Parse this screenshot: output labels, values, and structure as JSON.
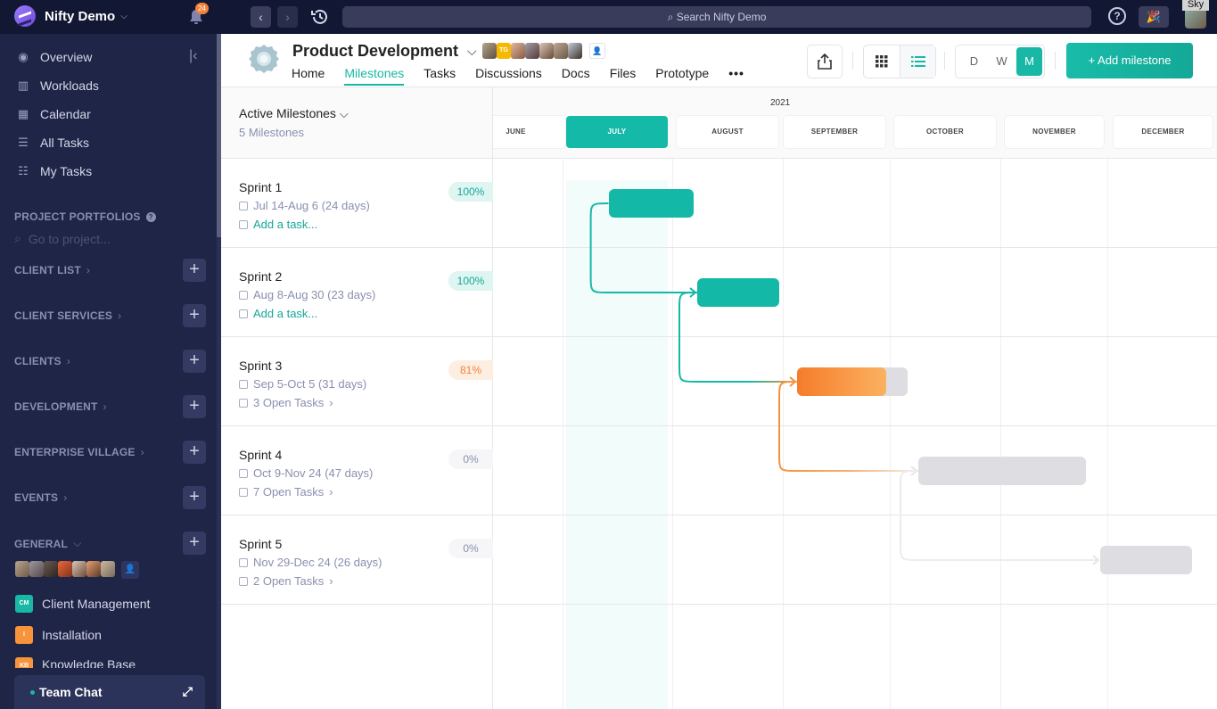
{
  "topbar": {
    "workspace_name": "Nifty Demo",
    "notification_count": "24",
    "search_placeholder": "Search Nifty Demo",
    "user_tooltip": "Sky",
    "back_glyph": "‹",
    "forward_glyph": "›",
    "help_glyph": "?",
    "party_glyph": "🎉"
  },
  "sidebar": {
    "nav": [
      {
        "label": "Overview",
        "icon": "compass-icon"
      },
      {
        "label": "Workloads",
        "icon": "bar-chart-icon"
      },
      {
        "label": "Calendar",
        "icon": "calendar-icon"
      },
      {
        "label": "All Tasks",
        "icon": "list-icon"
      },
      {
        "label": "My Tasks",
        "icon": "checklist-icon"
      }
    ],
    "portfolios_title": "PROJECT PORTFOLIOS",
    "goto_placeholder": "Go to project...",
    "sections": [
      {
        "label": "CLIENT LIST"
      },
      {
        "label": "CLIENT SERVICES"
      },
      {
        "label": "CLIENTS"
      },
      {
        "label": "DEVELOPMENT"
      },
      {
        "label": "ENTERPRISE VILLAGE"
      },
      {
        "label": "EVENTS"
      },
      {
        "label": "GENERAL"
      }
    ],
    "projects": [
      {
        "label": "Client Management",
        "badge": "CM",
        "color": "#19b7a5"
      },
      {
        "label": "Installation",
        "badge": "I",
        "color": "#f7933a"
      },
      {
        "label": "Knowledge Base",
        "badge": "KB",
        "color": "#f7933a"
      }
    ],
    "team_chat": "Team Chat",
    "plus_glyph": "+"
  },
  "project": {
    "title": "Product Development",
    "member_initials": "TG",
    "tabs": [
      "Home",
      "Milestones",
      "Tasks",
      "Discussions",
      "Docs",
      "Files",
      "Prototype"
    ],
    "active_tab": "Milestones",
    "more_glyph": "•••",
    "view_modes": [
      "D",
      "W",
      "M"
    ],
    "active_view_mode": "M",
    "add_milestone_label": "+ Add milestone"
  },
  "milestones_panel": {
    "title": "Active Milestones",
    "count_label": "5 Milestones",
    "items": [
      {
        "name": "Sprint 1",
        "dates": "Jul 14-Aug 6 (24 days)",
        "tasks": "Add a task...",
        "tasks_is_add": true,
        "percent": "100%",
        "progress": 1.0,
        "status": "complete"
      },
      {
        "name": "Sprint 2",
        "dates": "Aug 8-Aug 30 (23 days)",
        "tasks": "Add a task...",
        "tasks_is_add": true,
        "percent": "100%",
        "progress": 1.0,
        "status": "complete"
      },
      {
        "name": "Sprint 3",
        "dates": "Sep 5-Oct 5 (31 days)",
        "tasks": "3 Open Tasks",
        "tasks_is_add": false,
        "percent": "81%",
        "progress": 0.81,
        "status": "in-progress"
      },
      {
        "name": "Sprint 4",
        "dates": "Oct 9-Nov 24 (47 days)",
        "tasks": "7 Open Tasks",
        "tasks_is_add": false,
        "percent": "0%",
        "progress": 0,
        "status": "not-started"
      },
      {
        "name": "Sprint 5",
        "dates": "Nov 29-Dec 24 (26 days)",
        "tasks": "2 Open Tasks",
        "tasks_is_add": false,
        "percent": "0%",
        "progress": 0,
        "status": "not-started"
      }
    ]
  },
  "timeline": {
    "year": "2021",
    "months": [
      "JUNE",
      "JULY",
      "AUGUST",
      "SEPTEMBER",
      "OCTOBER",
      "NOVEMBER",
      "DECEMBER"
    ],
    "current_month": "JULY",
    "colors": {
      "complete": "#14b8a6",
      "in_progress_start": "#f57c2b",
      "in_progress_end": "#fbb261",
      "pending": "#dedee2"
    }
  }
}
